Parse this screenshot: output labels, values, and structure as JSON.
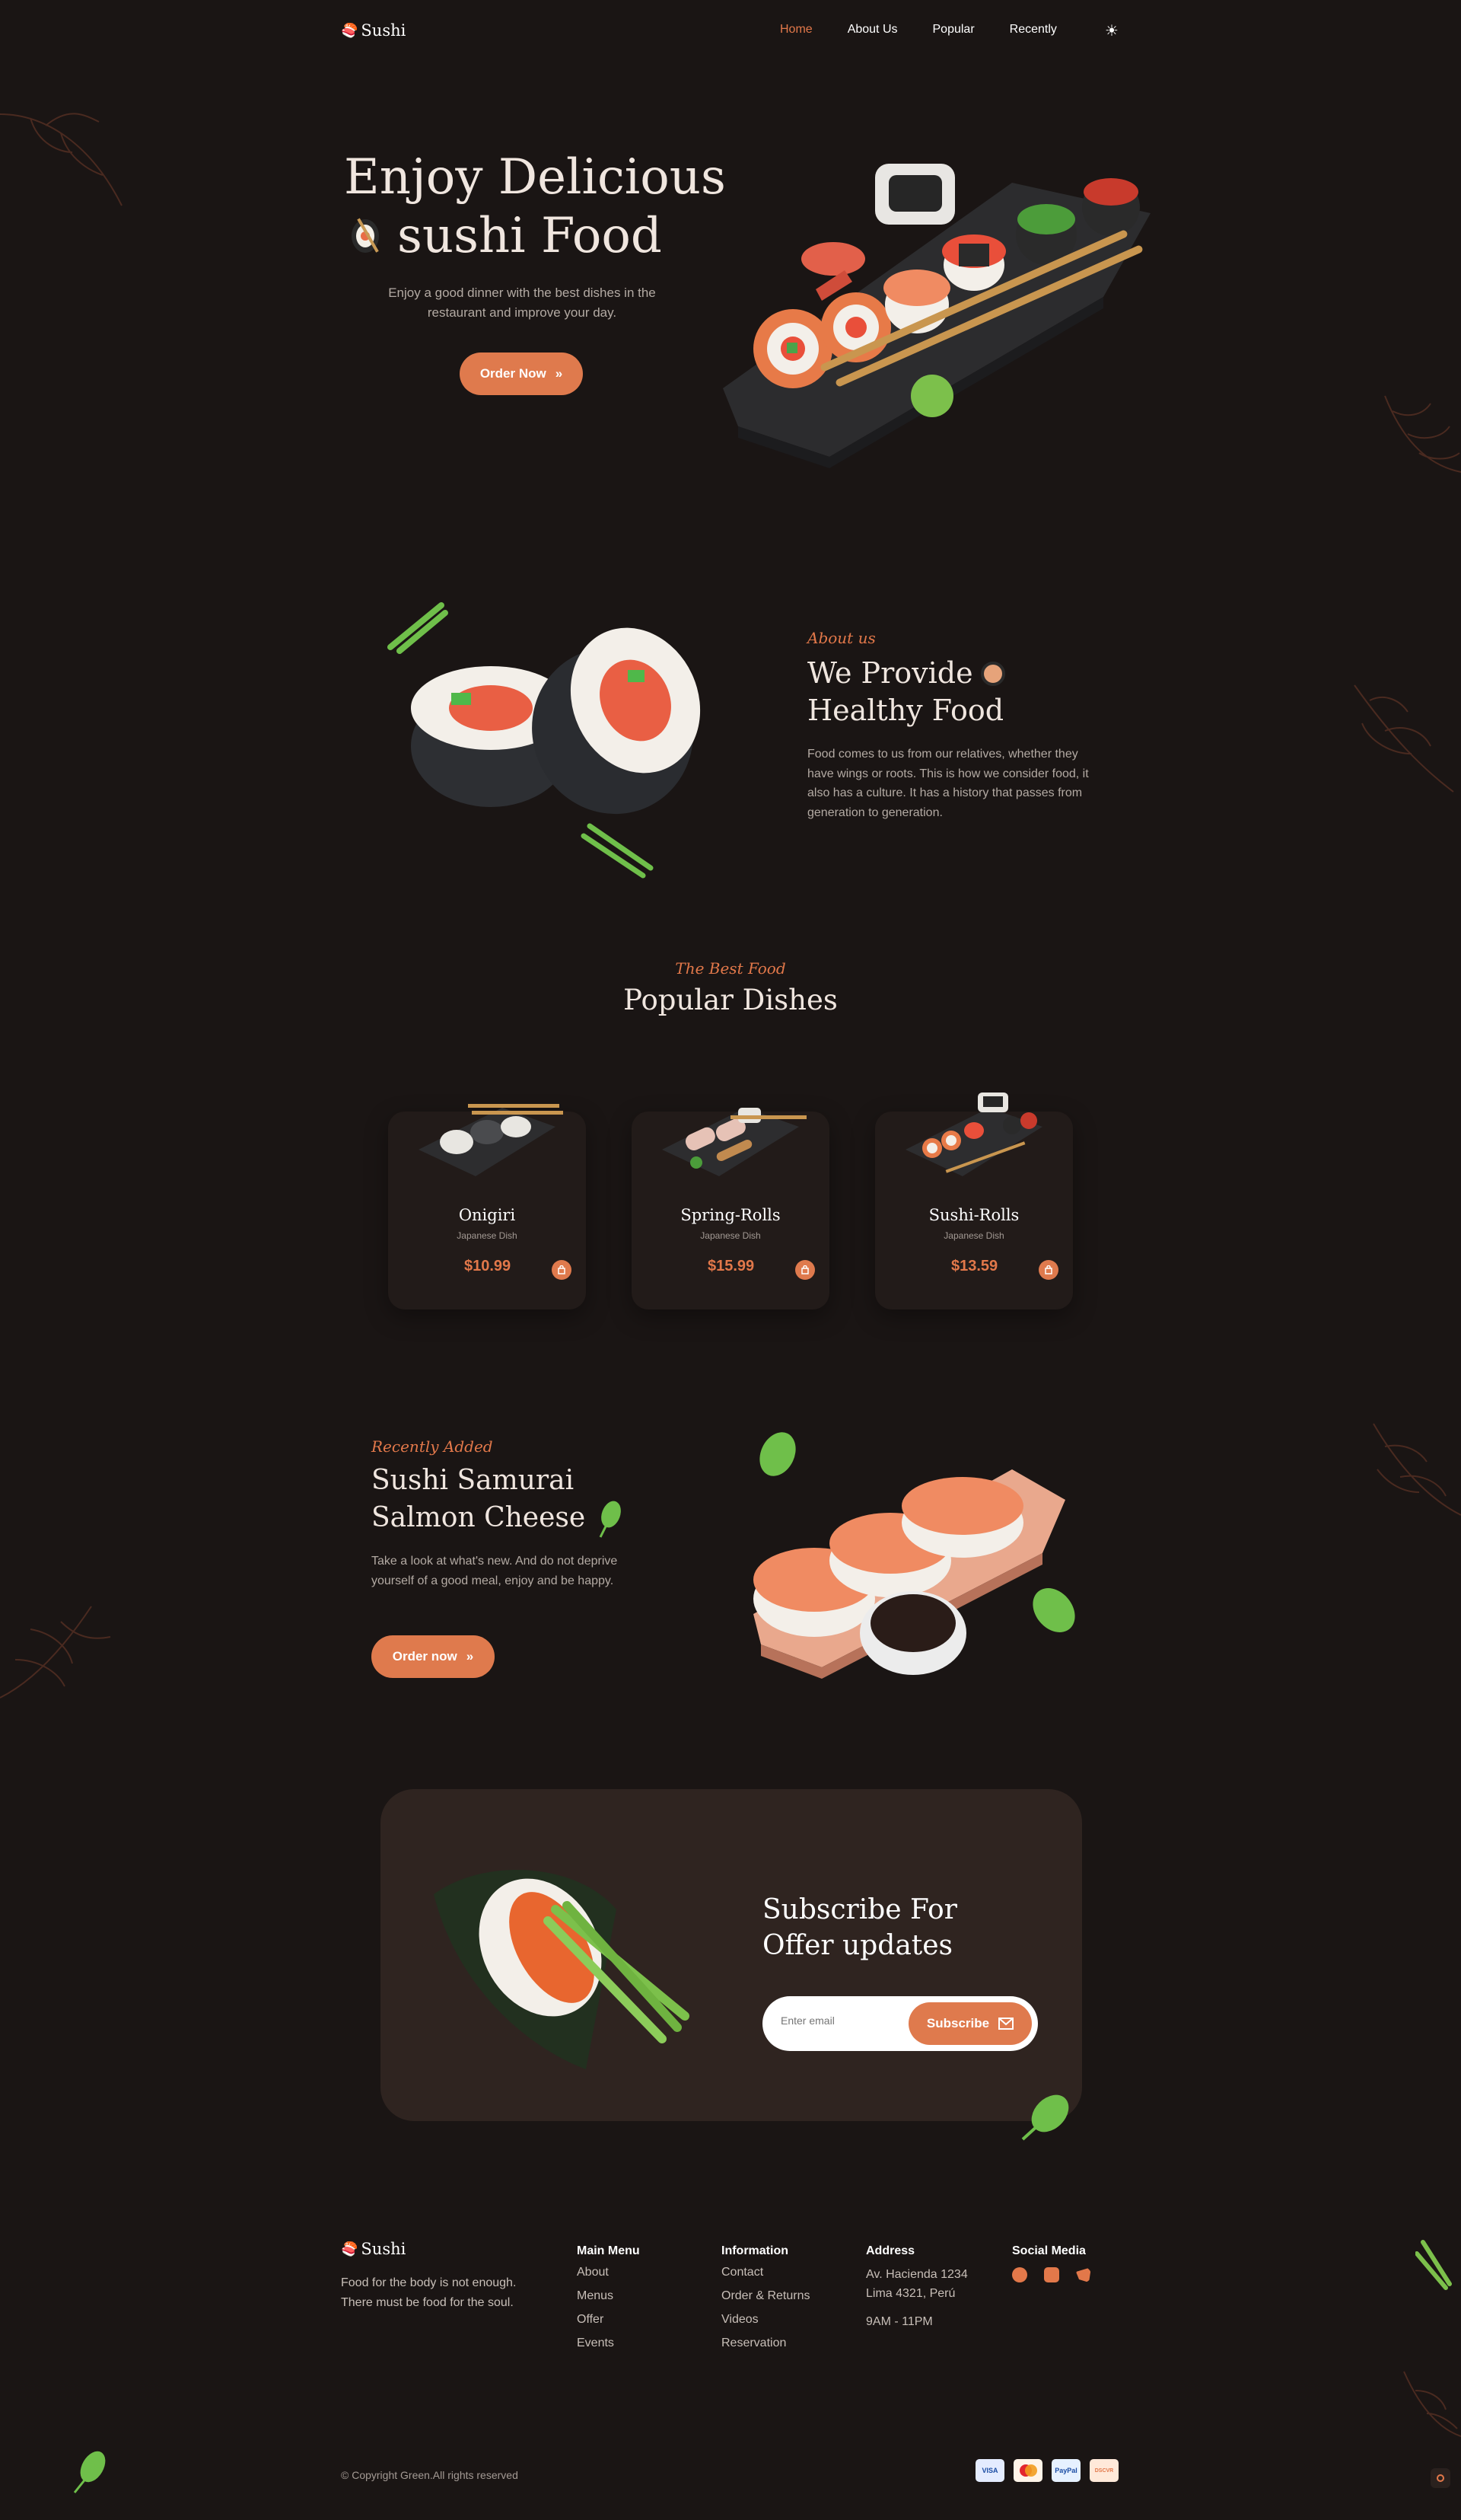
{
  "header": {
    "logo": "Sushi",
    "nav": [
      "Home",
      "About Us",
      "Popular",
      "Recently"
    ]
  },
  "hero": {
    "title_line1": "Enjoy Delicious",
    "title_line2": "sushi Food",
    "description": "Enjoy a good dinner with the best dishes in the restaurant and improve your day.",
    "cta": "Order Now"
  },
  "about": {
    "kicker": "About us",
    "title_line1": "We Provide",
    "title_line2": "Healthy Food",
    "description": "Food comes to us from our relatives, whether they have wings or roots. This is how we consider food, it also has a culture. It has a history that passes from generation to generation."
  },
  "popular": {
    "kicker": "The Best Food",
    "title": "Popular Dishes",
    "dishes": [
      {
        "name": "Onigiri",
        "type": "Japanese Dish",
        "price": "$10.99"
      },
      {
        "name": "Spring-Rolls",
        "type": "Japanese Dish",
        "price": "$15.99"
      },
      {
        "name": "Sushi-Rolls",
        "type": "Japanese Dish",
        "price": "$13.59"
      }
    ]
  },
  "recent": {
    "kicker": "Recently Added",
    "title_line1": "Sushi Samurai",
    "title_line2": "Salmon Cheese",
    "description": "Take a look at what's new. And do not deprive yourself of a good meal, enjoy and be happy.",
    "cta": "Order now"
  },
  "subscribe": {
    "title_line1": "Subscribe For",
    "title_line2": "Offer updates",
    "placeholder": "Enter email",
    "button": "Subscribe"
  },
  "footer": {
    "brand": "Sushi",
    "tagline": "Food for the body is not enough. There must be food for the soul.",
    "main_menu": {
      "title": "Main Menu",
      "items": [
        "About",
        "Menus",
        "Offer",
        "Events"
      ]
    },
    "information": {
      "title": "Information",
      "items": [
        "Contact",
        "Order & Returns",
        "Videos",
        "Reservation"
      ]
    },
    "address": {
      "title": "Address",
      "line1": "Av. Hacienda 1234",
      "line2": "Lima 4321, Perú",
      "hours": "9AM - 11PM"
    },
    "social": {
      "title": "Social Media",
      "icons": [
        "facebook-icon",
        "instagram-icon",
        "twitter-icon"
      ]
    },
    "copyright": "© Copyright Green.All rights reserved",
    "payments": [
      "VISA",
      "",
      "PayPal",
      "DSCVR"
    ]
  },
  "colors": {
    "background": "#1a1514",
    "accent": "#df7a4d",
    "card": "#221b19",
    "subscribe_bg": "#2f2420"
  }
}
